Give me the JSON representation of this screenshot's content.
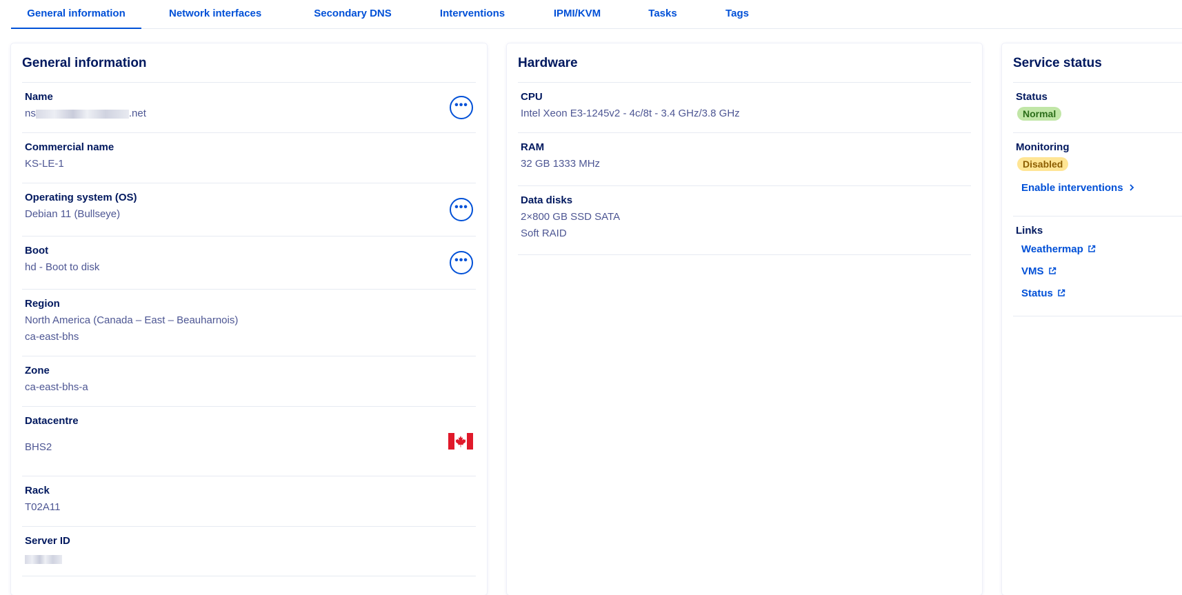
{
  "tabs": [
    {
      "label": "General information",
      "active": true
    },
    {
      "label": "Network interfaces"
    },
    {
      "label": "Secondary DNS"
    },
    {
      "label": "Interventions"
    },
    {
      "label": "IPMI/KVM"
    },
    {
      "label": "Tasks"
    },
    {
      "label": "Tags"
    }
  ],
  "general": {
    "title": "General information",
    "name_label": "Name",
    "name_prefix": "ns",
    "name_suffix": ".net",
    "commercial_label": "Commercial name",
    "commercial_value": "KS-LE-1",
    "os_label": "Operating system (OS)",
    "os_value": "Debian 11 (Bullseye)",
    "boot_label": "Boot",
    "boot_value": "hd - Boot to disk",
    "region_label": "Region",
    "region_value": "North America (Canada – East – Beauharnois)",
    "region_code": "ca-east-bhs",
    "zone_label": "Zone",
    "zone_value": "ca-east-bhs-a",
    "datacentre_label": "Datacentre",
    "datacentre_value": "BHS2",
    "rack_label": "Rack",
    "rack_value": "T02A11",
    "serverid_label": "Server ID",
    "more_glyph": "•••"
  },
  "hardware": {
    "title": "Hardware",
    "cpu_label": "CPU",
    "cpu_value": "Intel Xeon E3-1245v2 - 4c/8t - 3.4 GHz/3.8 GHz",
    "ram_label": "RAM",
    "ram_value": "32 GB 1333 MHz",
    "disks_label": "Data disks",
    "disks_value": "2×800 GB SSD SATA",
    "disks_raid": "Soft RAID"
  },
  "service": {
    "title": "Service status",
    "status_label": "Status",
    "status_value": "Normal",
    "monitoring_label": "Monitoring",
    "monitoring_value": "Disabled",
    "enable_link": "Enable interventions",
    "links_label": "Links",
    "links": [
      "Weathermap",
      "VMS",
      "Status"
    ]
  },
  "colors": {
    "accent": "#0050d7",
    "heading": "#00185e",
    "text": "#4d5693",
    "badge_ok_bg": "#c1e6a7",
    "badge_warn_bg": "#ffe594",
    "flag_red": "#e0192a"
  }
}
